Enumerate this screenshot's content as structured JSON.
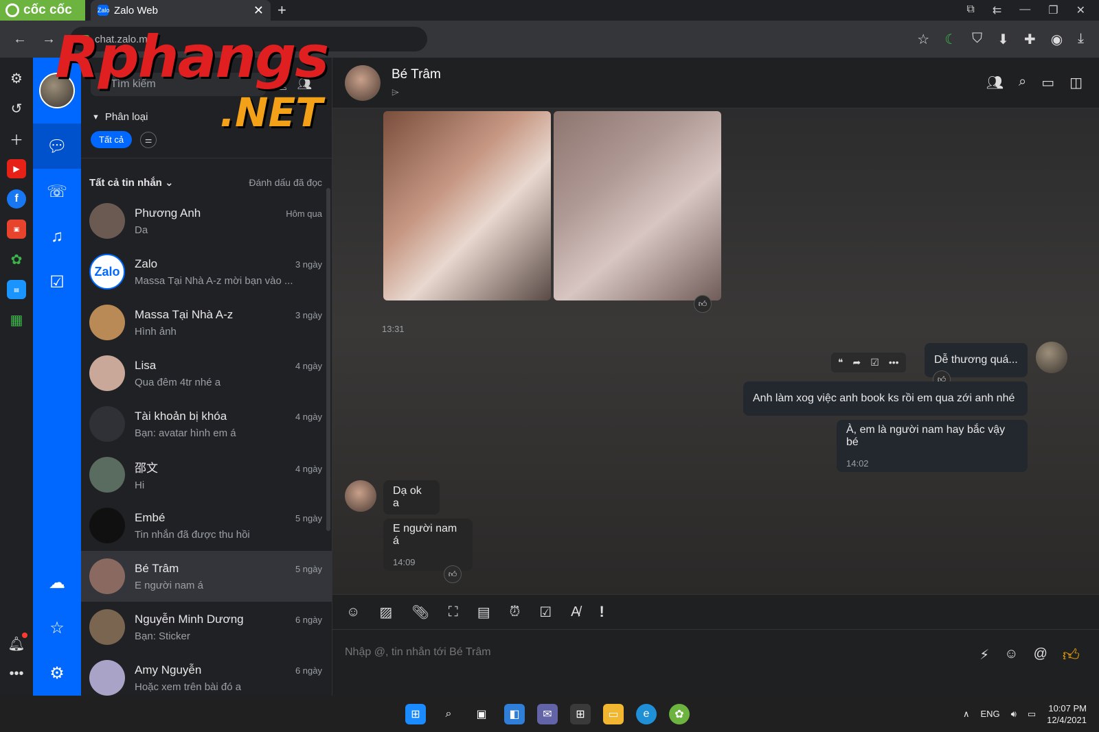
{
  "browser": {
    "brand": "cốc cốc",
    "tab_title": "Zalo Web",
    "tab_favicon": "Zalo",
    "url": "chat.zalo.me",
    "colors": {
      "brand_green": "#6cb33f",
      "zalo_blue": "#0068ff"
    }
  },
  "watermark": {
    "line1": "Rphangs",
    "line2": ".NET"
  },
  "sidebar": {
    "search_placeholder": "Tìm kiếm",
    "filter_label": "Phân loại",
    "chip_all": "Tất cả",
    "list_title": "Tất cả tin nhắn",
    "mark_read": "Đánh dấu đã đọc",
    "conversations": [
      {
        "name": "Phương Anh",
        "preview": "Da",
        "time": "Hôm qua",
        "color": "#6b5a52"
      },
      {
        "name": "Zalo",
        "preview": "Massa Tại Nhà A-z mời bạn vào ...",
        "time": "3 ngày",
        "logo": "Zalo"
      },
      {
        "name": "Massa Tại Nhà A-z",
        "preview": "Hình ảnh",
        "time": "3 ngày",
        "color": "#b98a55"
      },
      {
        "name": "Lisa",
        "preview": "Qua đêm 4tr nhé a",
        "time": "4 ngày",
        "color": "#c9a89a"
      },
      {
        "name": "Tài khoản bị khóa",
        "preview": "Bạn: avatar hình em á",
        "time": "4 ngày",
        "color": "#2f3137"
      },
      {
        "name": "邵文",
        "preview": "Hi",
        "time": "4 ngày",
        "color": "#5a6b60"
      },
      {
        "name": "Embé",
        "preview": "Tin nhắn đã được thu hồi",
        "time": "5 ngày",
        "color": "#101010"
      },
      {
        "name": "Bé Trâm",
        "preview": "E người nam á",
        "time": "5 ngày",
        "color": "#8a6a60"
      },
      {
        "name": "Nguyễn Minh Dương",
        "preview": "Bạn: Sticker",
        "time": "6 ngày",
        "color": "#7a6650"
      },
      {
        "name": "Amy Nguyễn",
        "preview": "Hoặc xem trên bài đó a",
        "time": "6 ngày",
        "color": "#a9a3c8"
      }
    ]
  },
  "chat": {
    "title": "Bé Trâm",
    "photo_time": "13:31",
    "messages": {
      "m1": "Dễ thương quá...",
      "m2": "Anh làm xog việc anh book ks rồi em qua zới anh nhé",
      "m3": "À, em là người nam hay bắc vậy bé",
      "m3_time": "14:02",
      "m4": "Dạ ok a",
      "m5": "E người nam á",
      "m5_time": "14:09"
    },
    "input_placeholder": "Nhập @, tin nhắn tới Bé Trâm"
  },
  "taskbar": {
    "lang": "ENG",
    "time": "10:07 PM",
    "date": "12/4/2021"
  }
}
